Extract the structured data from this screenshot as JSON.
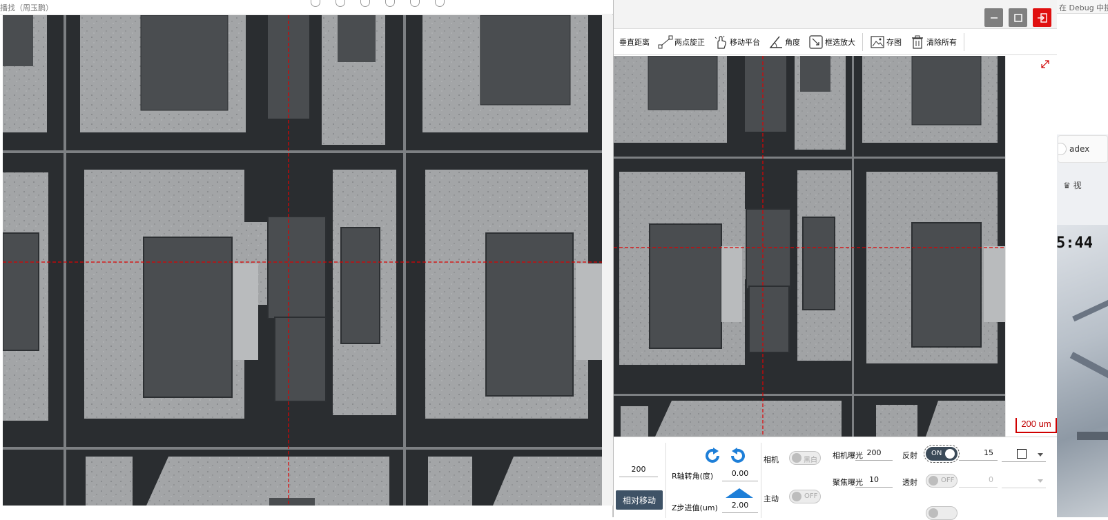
{
  "left_window": {
    "title": "播找（周玉鹏）"
  },
  "background_app": {
    "topbar_text": "在 Debug 中搜索",
    "user_text": "adex",
    "vip_text": "视",
    "clock_text": "5:44"
  },
  "main_window": {
    "toolbar": {
      "vertical_distance": "垂直距离",
      "two_point_rotate": "两点旋正",
      "move_stage": "移动平台",
      "angle": "角度",
      "box_zoom": "框选放大",
      "save_image": "存图",
      "clear_all": "清除所有"
    },
    "scale_bar_label": "200 um",
    "controls": {
      "step_value": "200",
      "r_axis_label": "R轴转角(度)",
      "r_axis_value": "0.00",
      "z_step_label": "Z步进值(um)",
      "z_step_value": "2.00",
      "relative_move_label": "相对移动",
      "camera_label": "相机",
      "camera_toggle_text": "黑白",
      "auto_label": "主动",
      "auto_toggle_text": "OFF",
      "camera_exposure_label": "相机曝光",
      "camera_exposure_value": "200",
      "focus_exposure_label": "聚焦曝光",
      "focus_exposure_value": "10",
      "reflect_label": "反射",
      "reflect_toggle_text": "ON",
      "reflect_value": "15",
      "transmit_label": "透射",
      "transmit_toggle_text": "OFF",
      "transmit_value": "0"
    }
  },
  "colors": {
    "accent_dark": "#3e5266",
    "crosshair": "#e00000",
    "exit_button": "#e01010",
    "rotate_icon": "#1e7fd8"
  }
}
